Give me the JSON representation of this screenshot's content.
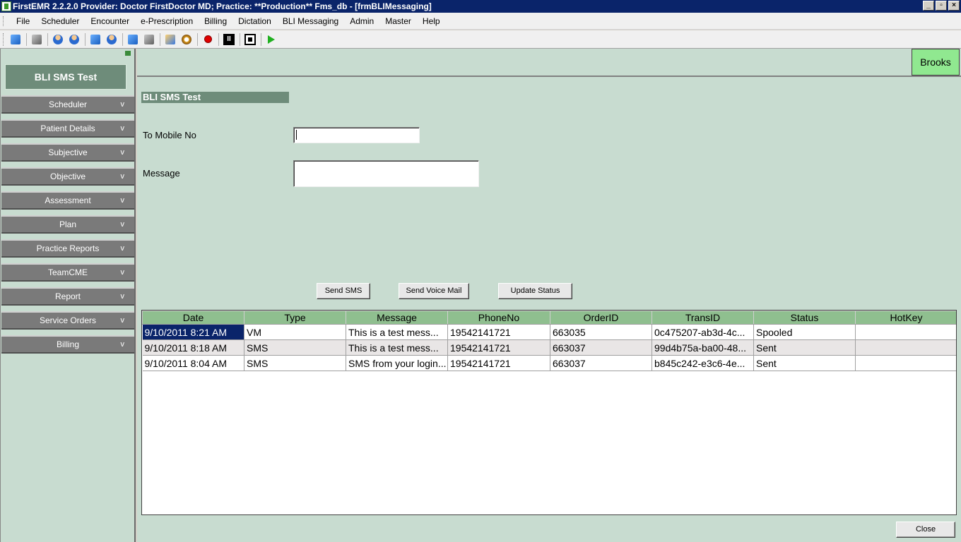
{
  "window": {
    "title": "FirstEMR 2.2.2.0 Provider: Doctor FirstDoctor MD; Practice: **Production** Fms_db - [frmBLIMessaging]",
    "controls": [
      "_",
      "▫",
      "×"
    ]
  },
  "menu": [
    "File",
    "Scheduler",
    "Encounter",
    "e-Prescription",
    "Billing",
    "Dictation",
    "BLI Messaging",
    "Admin",
    "Master",
    "Help"
  ],
  "toolbar": {
    "icons": [
      "window-icon",
      "sync-icon",
      "person-up-icon",
      "person-down-icon",
      "note-icon",
      "contact-icon",
      "import-icon",
      "export-icon",
      "home-icon",
      "timer-icon",
      "record-icon",
      "pause-icon",
      "stop-icon",
      "play-icon"
    ]
  },
  "sidebar": {
    "header": "BLI SMS Test",
    "items": [
      {
        "label": "Scheduler",
        "chev": "v"
      },
      {
        "label": "Patient Details",
        "chev": "v"
      },
      {
        "label": "Subjective",
        "chev": "v"
      },
      {
        "label": "Objective",
        "chev": "v"
      },
      {
        "label": "Assessment",
        "chev": "v"
      },
      {
        "label": "Plan",
        "chev": "v"
      },
      {
        "label": "Practice Reports",
        "chev": "v"
      },
      {
        "label": "TeamCME",
        "chev": "v"
      },
      {
        "label": "Report",
        "chev": "v"
      },
      {
        "label": "Service Orders",
        "chev": "v"
      },
      {
        "label": "Billing",
        "chev": "v"
      }
    ]
  },
  "header": {
    "user": "Brooks"
  },
  "form": {
    "title": "BLI SMS Test",
    "mobile_label": "To Mobile No",
    "mobile_value": "",
    "message_label": "Message",
    "message_value": "",
    "buttons": {
      "send_sms": "Send SMS",
      "send_voice": "Send Voice Mail",
      "update_status": "Update Status"
    }
  },
  "grid": {
    "columns": [
      "Date",
      "Type",
      "Message",
      "PhoneNo",
      "OrderID",
      "TransID",
      "Status",
      "HotKey"
    ],
    "rows": [
      [
        "9/10/2011 8:21 AM",
        "VM",
        "This is a test mess...",
        "19542141721",
        "663035",
        "0c475207-ab3d-4c...",
        "Spooled",
        ""
      ],
      [
        "9/10/2011 8:18 AM",
        "SMS",
        "This is a test mess...",
        "19542141721",
        "663037",
        "99d4b75a-ba00-48...",
        "Sent",
        ""
      ],
      [
        "9/10/2011 8:04 AM",
        "SMS",
        "SMS from your login...",
        "19542141721",
        "663037",
        "b845c242-e3c6-4e...",
        "Sent",
        ""
      ]
    ]
  },
  "footer": {
    "close": "Close"
  }
}
